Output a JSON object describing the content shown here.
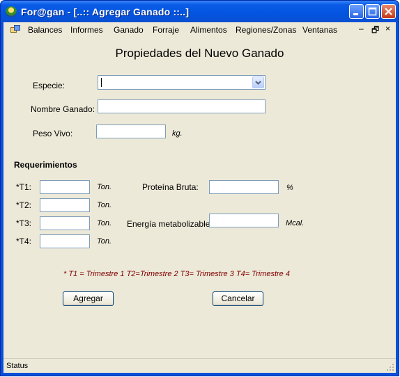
{
  "window": {
    "title": "For@gan - [..:: Agregar Ganado ::..]"
  },
  "menu": {
    "items": [
      "Balances",
      "Informes",
      "Ganado",
      "Forraje",
      "Alimentos",
      "Regiones/Zonas",
      "Ventanas"
    ],
    "mdi_minimize": "–",
    "mdi_restore": "🗗",
    "mdi_close": "×"
  },
  "form": {
    "heading": "Propiedades del Nuevo Ganado",
    "especie_label": "Especie:",
    "especie_value": "",
    "nombre_label": "Nombre Ganado:",
    "nombre_value": "",
    "peso_label": "Peso Vivo:",
    "peso_value": "",
    "peso_unit": "kg.",
    "requerimientos_label": "Requerimientos",
    "t_rows": [
      {
        "label": "*T1:",
        "value": "",
        "unit": "Ton."
      },
      {
        "label": "*T2:",
        "value": "",
        "unit": "Ton."
      },
      {
        "label": "*T3:",
        "value": "",
        "unit": "Ton."
      },
      {
        "label": "*T4:",
        "value": "",
        "unit": "Ton."
      }
    ],
    "proteina_label": "Proteína Bruta:",
    "proteina_value": "",
    "proteina_unit": "%",
    "energia_label": "Energía metabolizable:",
    "energia_value": "",
    "energia_unit": "Mcal.",
    "legend": "* T1 = Trimestre 1   T2=Trimestre 2   T3= Trimestre 3   T4= Trimestre 4",
    "agregar_button": "Agregar",
    "cancelar_button": "Cancelar"
  },
  "status": {
    "text": "Status"
  },
  "colors": {
    "title_blue": "#0354e0",
    "face": "#ece9d8",
    "legend_text": "#800000",
    "field_border": "#7f9db9"
  }
}
